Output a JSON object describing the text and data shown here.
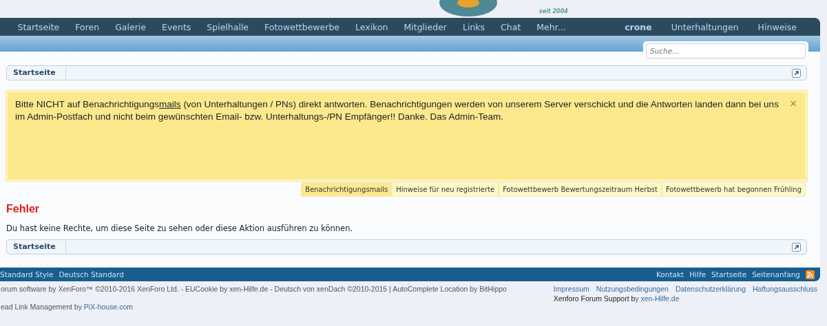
{
  "logo": {
    "tagline": "seit 2004"
  },
  "nav": {
    "items": [
      {
        "label": "Startseite"
      },
      {
        "label": "Foren"
      },
      {
        "label": "Galerie"
      },
      {
        "label": "Events"
      },
      {
        "label": "Spielhalle"
      },
      {
        "label": "Fotowettbewerbe"
      },
      {
        "label": "Lexikon"
      },
      {
        "label": "Mitglieder"
      },
      {
        "label": "Links"
      },
      {
        "label": "Chat"
      },
      {
        "label": "Mehr..."
      }
    ],
    "user": "crone",
    "right_items": [
      {
        "label": "Unterhaltungen"
      },
      {
        "label": "Hinweise"
      }
    ]
  },
  "search": {
    "placeholder": "Suche..."
  },
  "breadcrumb_top": {
    "label": "Startseite"
  },
  "notice": {
    "text_before": "Bitte NICHT auf Benachrichtigungs",
    "link": "mails",
    "text_after": " (von Unterhaltungen / PNs) direkt antworten. Benachrichtigungen werden von unserem Server verschickt und die Antworten landen dann bei uns im Admin-Postfach und nicht beim gewünschten Email- bzw. Unterhaltungs-/PN Empfänger!! Danke. Das Admin-Team.",
    "close": "×"
  },
  "notice_tabs": [
    {
      "label": "Benachrichtigungsmails",
      "selected": true
    },
    {
      "label": "Hinweise für neu registrierte",
      "selected": false
    },
    {
      "label": "Fotowettbewerb Bewertungszeitraum Herbst",
      "selected": false
    },
    {
      "label": "Fotowettbewerb hat begonnen Frühling",
      "selected": false
    }
  ],
  "error": {
    "title": "Fehler",
    "message": "Du hast keine Rechte, um diese Seite zu sehen oder diese Aktion ausführen zu können."
  },
  "breadcrumb_bottom": {
    "label": "Startseite"
  },
  "footer_bar": {
    "left": [
      "Standard Style",
      "Deutsch Standard"
    ],
    "right": [
      "Kontakt",
      "Hilfe",
      "Startseite",
      "Seitenanfang"
    ]
  },
  "copyright": {
    "line1": "orum software by XenForo™ ©2010-2016 XenForo Ltd. - EUCookie by xen-Hilfe.de - Deutsch von xenDach ©2010-2015 | AutoComplete Location by BitHippo",
    "line2_text": "ead Link Management by ",
    "line2_link": "PiX-house.com"
  },
  "footer_links": [
    "Impressum",
    "Nutzungsbedingungen",
    "Datenschutzerklärung",
    "Haftungsausschluss"
  ],
  "support": {
    "text": "Xenforo Forum Support b",
    "link": "y xen-Hilfe.de"
  }
}
